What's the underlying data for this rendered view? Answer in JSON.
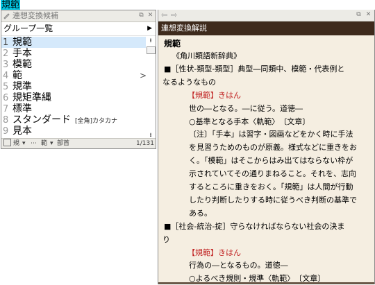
{
  "composition": "規範",
  "candidate_window": {
    "title": "連想変換候補",
    "group_label": "グループ一覧",
    "items": [
      {
        "num": "1",
        "text": "規範",
        "annotation": "",
        "sub": ""
      },
      {
        "num": "2",
        "text": "手本",
        "annotation": "",
        "sub": ""
      },
      {
        "num": "3",
        "text": "模範",
        "annotation": "",
        "sub": ""
      },
      {
        "num": "4",
        "text": "範",
        "annotation": "",
        "sub": ">"
      },
      {
        "num": "5",
        "text": "規準",
        "annotation": "",
        "sub": ""
      },
      {
        "num": "6",
        "text": "規矩準縄",
        "annotation": "",
        "sub": ""
      },
      {
        "num": "7",
        "text": "標準",
        "annotation": "",
        "sub": ""
      },
      {
        "num": "8",
        "text": "スタンダード",
        "annotation": "[全角]カタカナ",
        "sub": ""
      },
      {
        "num": "9",
        "text": "見本",
        "annotation": "",
        "sub": ""
      }
    ],
    "footer": {
      "tab1": "規",
      "tab2": "範",
      "tab3": "部首",
      "page": "1/131"
    }
  },
  "explanation_window": {
    "title": "連想変換解説",
    "headword": "規範",
    "lines": [
      {
        "text": "《角川類語新辞典》",
        "style": "normal",
        "indent": 2
      },
      {
        "text": "■［性状-類型-類型］典型―同類中、模範・代表例と",
        "style": "normal",
        "indent": 1
      },
      {
        "text": "なるようなもの",
        "style": "normal",
        "indent": 0
      },
      {
        "text": "【規範】きはん",
        "style": "red",
        "indent": 3
      },
      {
        "text": "世の―となる。―に従う。道徳―",
        "style": "normal",
        "indent": 4
      },
      {
        "text": "○基準となる手本〈軌範〉　〔文章〕",
        "style": "normal",
        "indent": 4
      },
      {
        "text": "〔注〕「手本」は習字・図画などをかく時に手法",
        "style": "normal",
        "indent": 4
      },
      {
        "text": "を見習うためのものが原義。様式などに重きをお",
        "style": "normal",
        "indent": 4
      },
      {
        "text": "く。「模範」はそこからはみ出てはならない枠が",
        "style": "normal",
        "indent": 4
      },
      {
        "text": "示されていてその通りまねること。それを、志向",
        "style": "normal",
        "indent": 4
      },
      {
        "text": "するところに重きをおく。「規範」は人間が行動",
        "style": "normal",
        "indent": 4
      },
      {
        "text": "したり判断したりする時に従うべき判断の基準で",
        "style": "normal",
        "indent": 4
      },
      {
        "text": "ある。",
        "style": "normal",
        "indent": 4
      },
      {
        "text": "■［社会-統治-掟］守らなければならない社会の決ま",
        "style": "normal",
        "indent": 1
      },
      {
        "text": "り",
        "style": "normal",
        "indent": 0
      },
      {
        "text": "【規範】きはん",
        "style": "red",
        "indent": 3
      },
      {
        "text": "行為の―となるもの。道徳―",
        "style": "normal",
        "indent": 4
      },
      {
        "text": "○よるべき規則・規準〈軌範〉　〔文章〕",
        "style": "normal",
        "indent": 4
      }
    ]
  }
}
